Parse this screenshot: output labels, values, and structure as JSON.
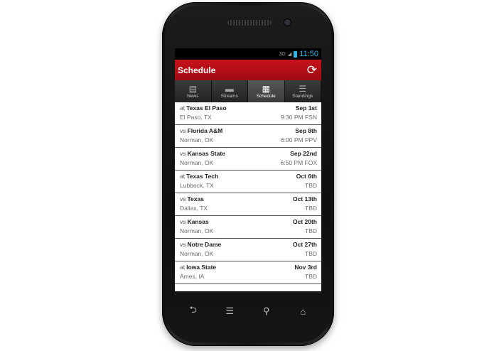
{
  "status": {
    "network": "3G",
    "time": "11:50"
  },
  "header": {
    "title": "Schedule"
  },
  "tabs": [
    {
      "label": "News",
      "icon": "news-icon"
    },
    {
      "label": "Streams",
      "icon": "video-icon"
    },
    {
      "label": "Schedule",
      "icon": "calendar-icon",
      "active": true
    },
    {
      "label": "Standings",
      "icon": "list-icon"
    }
  ],
  "games": [
    {
      "prefix": "at",
      "opponent": "Texas El Paso",
      "date": "Sep 1st",
      "location": "El Paso, TX",
      "info": "9:30 PM FSN"
    },
    {
      "prefix": "vs",
      "opponent": "Florida A&M",
      "date": "Sep 8th",
      "location": "Norman, OK",
      "info": "6:00 PM PPV"
    },
    {
      "prefix": "vs",
      "opponent": "Kansas State",
      "date": "Sep 22nd",
      "location": "Norman, OK",
      "info": "6:50 PM FOX"
    },
    {
      "prefix": "at",
      "opponent": "Texas Tech",
      "date": "Oct 6th",
      "location": "Lubbock, TX",
      "info": "TBD"
    },
    {
      "prefix": "vs",
      "opponent": "Texas",
      "date": "Oct 13th",
      "location": "Dallas, TX",
      "info": "TBD"
    },
    {
      "prefix": "vs",
      "opponent": "Kansas",
      "date": "Oct 20th",
      "location": "Norman, OK",
      "info": "TBD"
    },
    {
      "prefix": "vs",
      "opponent": "Notre Dame",
      "date": "Oct 27th",
      "location": "Norman, OK",
      "info": "TBD"
    },
    {
      "prefix": "at",
      "opponent": "Iowa State",
      "date": "Nov 3rd",
      "location": "Ames, IA",
      "info": "TBD"
    }
  ],
  "nav": {
    "back": "back-icon",
    "menu": "menu-icon",
    "search": "search-icon",
    "home": "home-icon"
  },
  "colors": {
    "accent": "#c7111a",
    "status_time": "#33b5e5"
  }
}
